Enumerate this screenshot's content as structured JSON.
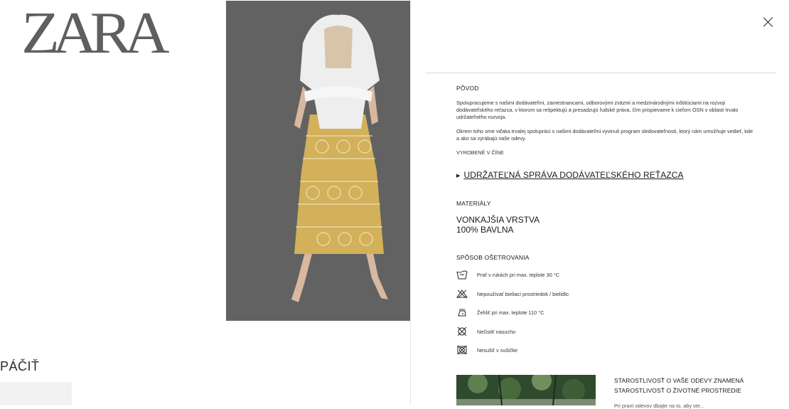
{
  "brand": {
    "logo_text": "ZARA"
  },
  "left": {
    "heading": "PÁČIŤ"
  },
  "photo": {
    "background": "#626262",
    "skirt_color": "#d2b15a"
  },
  "panel": {
    "close_label": "×",
    "origin": {
      "title": "PÔVOD",
      "paragraph1": "Spolupracujeme s našimi dodávateľmi, zamestnancami, odborovými zväzmi a medzinárodnými inštitúciami na rozvoji dodávateľského reťazca, v ktorom sa rešpektujú a presadzujú ľudské práva, čím prispievame k cieľom OSN v oblasti trvalo udržateľného rozvoja.",
      "paragraph2": "Okrem toho sme vďaka trvalej spolupráci s našimi dodávateľmi vyvinuli program sledovateľnosti, ktorý nám umožňuje vedieť, kde a ako sa vyrábajú naše odevy.",
      "made_in": "VYROBENÉ V ČÍNE",
      "supply_chain_link": "UDRŽATEĽNÁ SPRÁVA DODÁVATEĽSKÉHO REŤAZCA"
    },
    "materials": {
      "title": "MATERIÁLY",
      "layer": "VONKAJŠIA VRSTVA",
      "composition": "100% BAVLNA"
    },
    "care": {
      "title": "SPÔSOB OŠETROVANIA",
      "items": [
        {
          "icon": "hand-wash-icon",
          "text": "Prať v rukách pri max. teplote 30 °C"
        },
        {
          "icon": "no-bleach-icon",
          "text": "Nepoužívať bieliaci prostriedok / bielidlo"
        },
        {
          "icon": "iron-icon",
          "text": "Žehliť pri max. teplote 110 °C"
        },
        {
          "icon": "no-dry-clean-icon",
          "text": "Nečistiť nasucho"
        },
        {
          "icon": "no-tumble-dry-icon",
          "text": "Nesušiť v sušičke"
        }
      ]
    },
    "promo": {
      "title_line1": "STAROSTLIVOSŤ O VAŠE ODEVY ZNAMENÁ",
      "title_line2": "STAROSTLIVOSŤ O ŽIVOTNÉ PROSTREDIE",
      "body": "Pri praní odevov dbajte na to, aby ste..."
    }
  }
}
